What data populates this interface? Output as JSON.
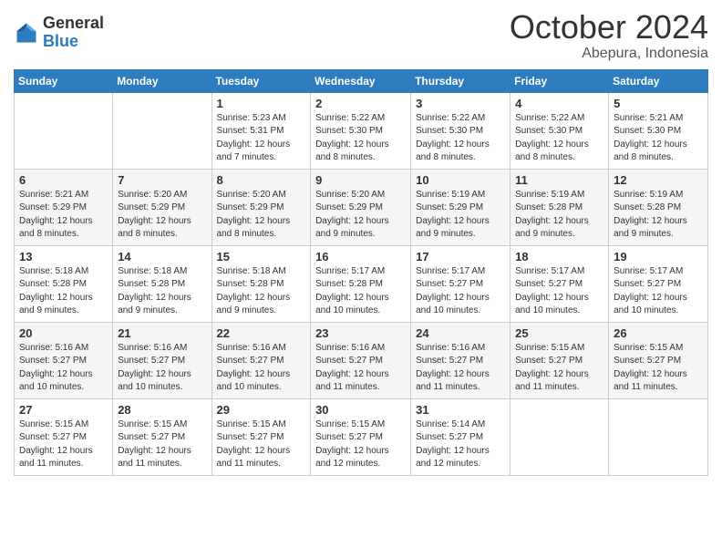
{
  "logo": {
    "general": "General",
    "blue": "Blue"
  },
  "header": {
    "month": "October 2024",
    "location": "Abepura, Indonesia"
  },
  "weekdays": [
    "Sunday",
    "Monday",
    "Tuesday",
    "Wednesday",
    "Thursday",
    "Friday",
    "Saturday"
  ],
  "weeks": [
    [
      {
        "day": null,
        "sunrise": null,
        "sunset": null,
        "daylight": null
      },
      {
        "day": null,
        "sunrise": null,
        "sunset": null,
        "daylight": null
      },
      {
        "day": "1",
        "sunrise": "Sunrise: 5:23 AM",
        "sunset": "Sunset: 5:31 PM",
        "daylight": "Daylight: 12 hours and 7 minutes."
      },
      {
        "day": "2",
        "sunrise": "Sunrise: 5:22 AM",
        "sunset": "Sunset: 5:30 PM",
        "daylight": "Daylight: 12 hours and 8 minutes."
      },
      {
        "day": "3",
        "sunrise": "Sunrise: 5:22 AM",
        "sunset": "Sunset: 5:30 PM",
        "daylight": "Daylight: 12 hours and 8 minutes."
      },
      {
        "day": "4",
        "sunrise": "Sunrise: 5:22 AM",
        "sunset": "Sunset: 5:30 PM",
        "daylight": "Daylight: 12 hours and 8 minutes."
      },
      {
        "day": "5",
        "sunrise": "Sunrise: 5:21 AM",
        "sunset": "Sunset: 5:30 PM",
        "daylight": "Daylight: 12 hours and 8 minutes."
      }
    ],
    [
      {
        "day": "6",
        "sunrise": "Sunrise: 5:21 AM",
        "sunset": "Sunset: 5:29 PM",
        "daylight": "Daylight: 12 hours and 8 minutes."
      },
      {
        "day": "7",
        "sunrise": "Sunrise: 5:20 AM",
        "sunset": "Sunset: 5:29 PM",
        "daylight": "Daylight: 12 hours and 8 minutes."
      },
      {
        "day": "8",
        "sunrise": "Sunrise: 5:20 AM",
        "sunset": "Sunset: 5:29 PM",
        "daylight": "Daylight: 12 hours and 8 minutes."
      },
      {
        "day": "9",
        "sunrise": "Sunrise: 5:20 AM",
        "sunset": "Sunset: 5:29 PM",
        "daylight": "Daylight: 12 hours and 9 minutes."
      },
      {
        "day": "10",
        "sunrise": "Sunrise: 5:19 AM",
        "sunset": "Sunset: 5:29 PM",
        "daylight": "Daylight: 12 hours and 9 minutes."
      },
      {
        "day": "11",
        "sunrise": "Sunrise: 5:19 AM",
        "sunset": "Sunset: 5:28 PM",
        "daylight": "Daylight: 12 hours and 9 minutes."
      },
      {
        "day": "12",
        "sunrise": "Sunrise: 5:19 AM",
        "sunset": "Sunset: 5:28 PM",
        "daylight": "Daylight: 12 hours and 9 minutes."
      }
    ],
    [
      {
        "day": "13",
        "sunrise": "Sunrise: 5:18 AM",
        "sunset": "Sunset: 5:28 PM",
        "daylight": "Daylight: 12 hours and 9 minutes."
      },
      {
        "day": "14",
        "sunrise": "Sunrise: 5:18 AM",
        "sunset": "Sunset: 5:28 PM",
        "daylight": "Daylight: 12 hours and 9 minutes."
      },
      {
        "day": "15",
        "sunrise": "Sunrise: 5:18 AM",
        "sunset": "Sunset: 5:28 PM",
        "daylight": "Daylight: 12 hours and 9 minutes."
      },
      {
        "day": "16",
        "sunrise": "Sunrise: 5:17 AM",
        "sunset": "Sunset: 5:28 PM",
        "daylight": "Daylight: 12 hours and 10 minutes."
      },
      {
        "day": "17",
        "sunrise": "Sunrise: 5:17 AM",
        "sunset": "Sunset: 5:27 PM",
        "daylight": "Daylight: 12 hours and 10 minutes."
      },
      {
        "day": "18",
        "sunrise": "Sunrise: 5:17 AM",
        "sunset": "Sunset: 5:27 PM",
        "daylight": "Daylight: 12 hours and 10 minutes."
      },
      {
        "day": "19",
        "sunrise": "Sunrise: 5:17 AM",
        "sunset": "Sunset: 5:27 PM",
        "daylight": "Daylight: 12 hours and 10 minutes."
      }
    ],
    [
      {
        "day": "20",
        "sunrise": "Sunrise: 5:16 AM",
        "sunset": "Sunset: 5:27 PM",
        "daylight": "Daylight: 12 hours and 10 minutes."
      },
      {
        "day": "21",
        "sunrise": "Sunrise: 5:16 AM",
        "sunset": "Sunset: 5:27 PM",
        "daylight": "Daylight: 12 hours and 10 minutes."
      },
      {
        "day": "22",
        "sunrise": "Sunrise: 5:16 AM",
        "sunset": "Sunset: 5:27 PM",
        "daylight": "Daylight: 12 hours and 10 minutes."
      },
      {
        "day": "23",
        "sunrise": "Sunrise: 5:16 AM",
        "sunset": "Sunset: 5:27 PM",
        "daylight": "Daylight: 12 hours and 11 minutes."
      },
      {
        "day": "24",
        "sunrise": "Sunrise: 5:16 AM",
        "sunset": "Sunset: 5:27 PM",
        "daylight": "Daylight: 12 hours and 11 minutes."
      },
      {
        "day": "25",
        "sunrise": "Sunrise: 5:15 AM",
        "sunset": "Sunset: 5:27 PM",
        "daylight": "Daylight: 12 hours and 11 minutes."
      },
      {
        "day": "26",
        "sunrise": "Sunrise: 5:15 AM",
        "sunset": "Sunset: 5:27 PM",
        "daylight": "Daylight: 12 hours and 11 minutes."
      }
    ],
    [
      {
        "day": "27",
        "sunrise": "Sunrise: 5:15 AM",
        "sunset": "Sunset: 5:27 PM",
        "daylight": "Daylight: 12 hours and 11 minutes."
      },
      {
        "day": "28",
        "sunrise": "Sunrise: 5:15 AM",
        "sunset": "Sunset: 5:27 PM",
        "daylight": "Daylight: 12 hours and 11 minutes."
      },
      {
        "day": "29",
        "sunrise": "Sunrise: 5:15 AM",
        "sunset": "Sunset: 5:27 PM",
        "daylight": "Daylight: 12 hours and 11 minutes."
      },
      {
        "day": "30",
        "sunrise": "Sunrise: 5:15 AM",
        "sunset": "Sunset: 5:27 PM",
        "daylight": "Daylight: 12 hours and 12 minutes."
      },
      {
        "day": "31",
        "sunrise": "Sunrise: 5:14 AM",
        "sunset": "Sunset: 5:27 PM",
        "daylight": "Daylight: 12 hours and 12 minutes."
      },
      {
        "day": null,
        "sunrise": null,
        "sunset": null,
        "daylight": null
      },
      {
        "day": null,
        "sunrise": null,
        "sunset": null,
        "daylight": null
      }
    ]
  ]
}
